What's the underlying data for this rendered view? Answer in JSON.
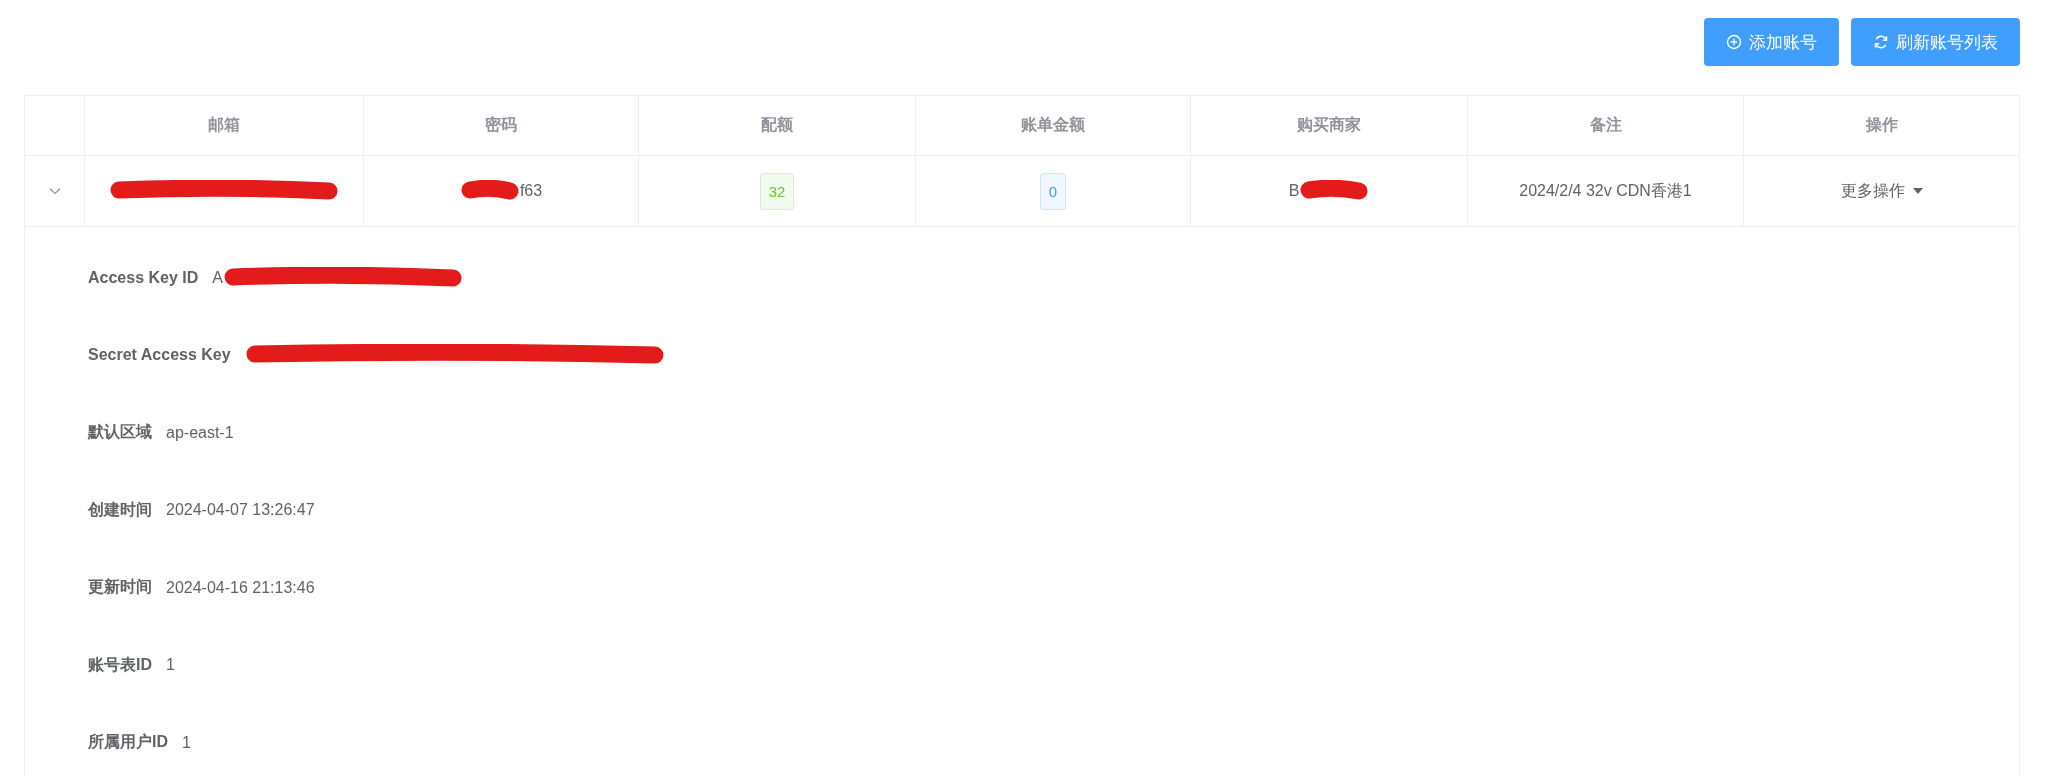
{
  "toolbar": {
    "buttons": [
      {
        "kind": "add",
        "label": "添加账号"
      },
      {
        "kind": "refresh",
        "label": "刷新账号列表"
      }
    ]
  },
  "table": {
    "columns": [
      "邮箱",
      "密码",
      "配额",
      "账单金额",
      "购买商家",
      "备注",
      "操作"
    ],
    "rows": [
      {
        "expanded": true,
        "cells": [
          {
            "kind": "text",
            "redacted": true
          },
          {
            "kind": "text",
            "text": "f63",
            "redacted": true
          },
          {
            "kind": "tag",
            "text": "32",
            "color": "#67c23a"
          },
          {
            "kind": "tag",
            "text": "0",
            "color": "#409eff"
          },
          {
            "kind": "text",
            "text": "B",
            "redacted": true
          },
          {
            "kind": "text",
            "text": "2024/2/4 32v CDN香港1"
          },
          {
            "kind": "menu",
            "text": "更多操作"
          }
        ],
        "details": [
          {
            "label": "Access Key ID",
            "value": "A",
            "redacted": true
          },
          {
            "label": "Secret Access Key",
            "redacted": true
          },
          {
            "label": "默认区域",
            "value": "ap-east-1"
          },
          {
            "label": "创建时间",
            "value": "2024-04-07 13:26:47"
          },
          {
            "label": "更新时间",
            "value": "2024-04-16 21:13:46"
          },
          {
            "label": "账号表ID",
            "value": "1"
          },
          {
            "label": "所属用户ID",
            "value": "1"
          }
        ]
      }
    ]
  }
}
